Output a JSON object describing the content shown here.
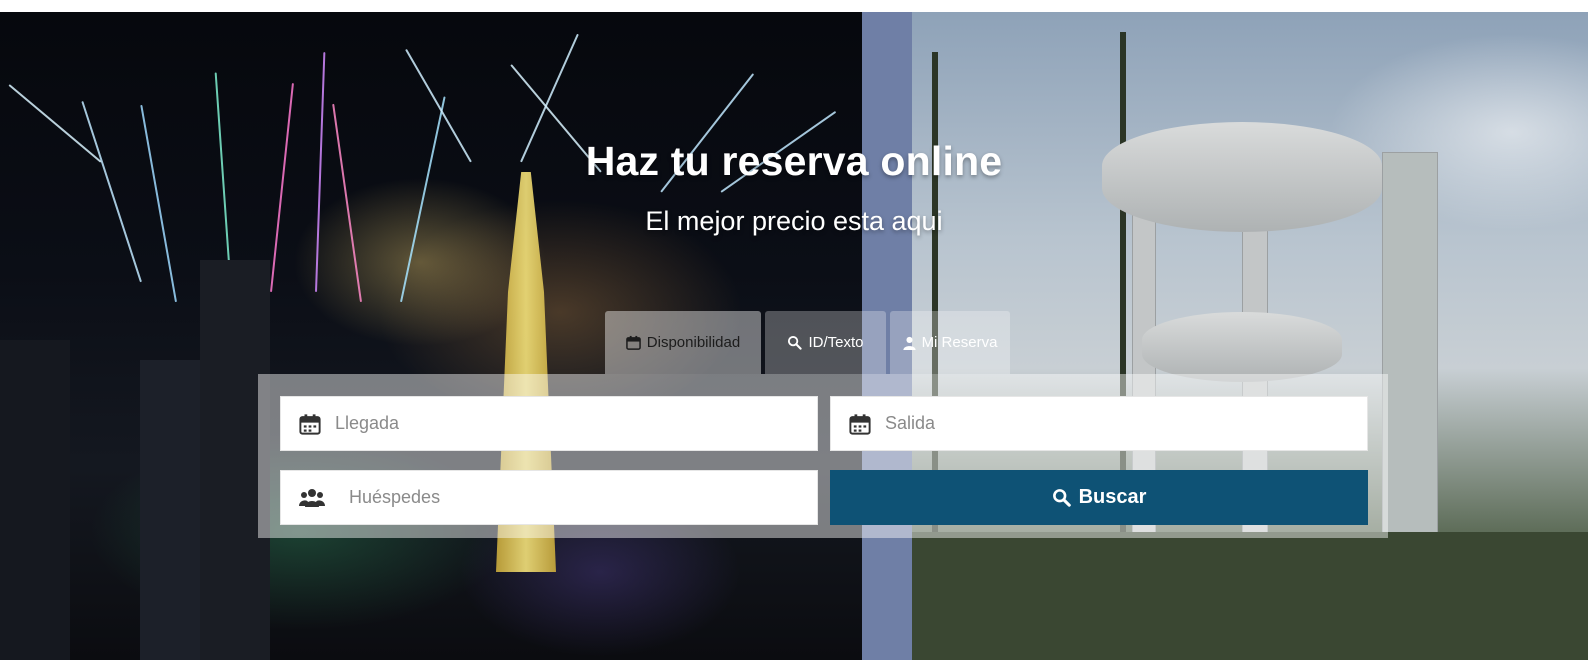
{
  "hero": {
    "title": "Haz tu reserva online",
    "subtitle": "El mejor precio esta aqui"
  },
  "tabs": [
    {
      "label": "Disponibilidad",
      "icon": "calendar-icon",
      "active": true
    },
    {
      "label": "ID/Texto",
      "icon": "search-icon",
      "active": false
    },
    {
      "label": "Mi Reserva",
      "icon": "user-icon",
      "active": false
    }
  ],
  "form": {
    "arrival": {
      "placeholder": "Llegada",
      "icon": "calendar-icon"
    },
    "departure": {
      "placeholder": "Salida",
      "icon": "calendar-icon"
    },
    "guests": {
      "placeholder": "Huéspedes",
      "icon": "users-icon"
    },
    "search_button": {
      "label": "Buscar",
      "icon": "search-icon"
    }
  },
  "colors": {
    "primary": "#0e5275",
    "stripe": "#6f7fa6",
    "panel_overlay": "rgba(255,255,255,0.45)"
  }
}
